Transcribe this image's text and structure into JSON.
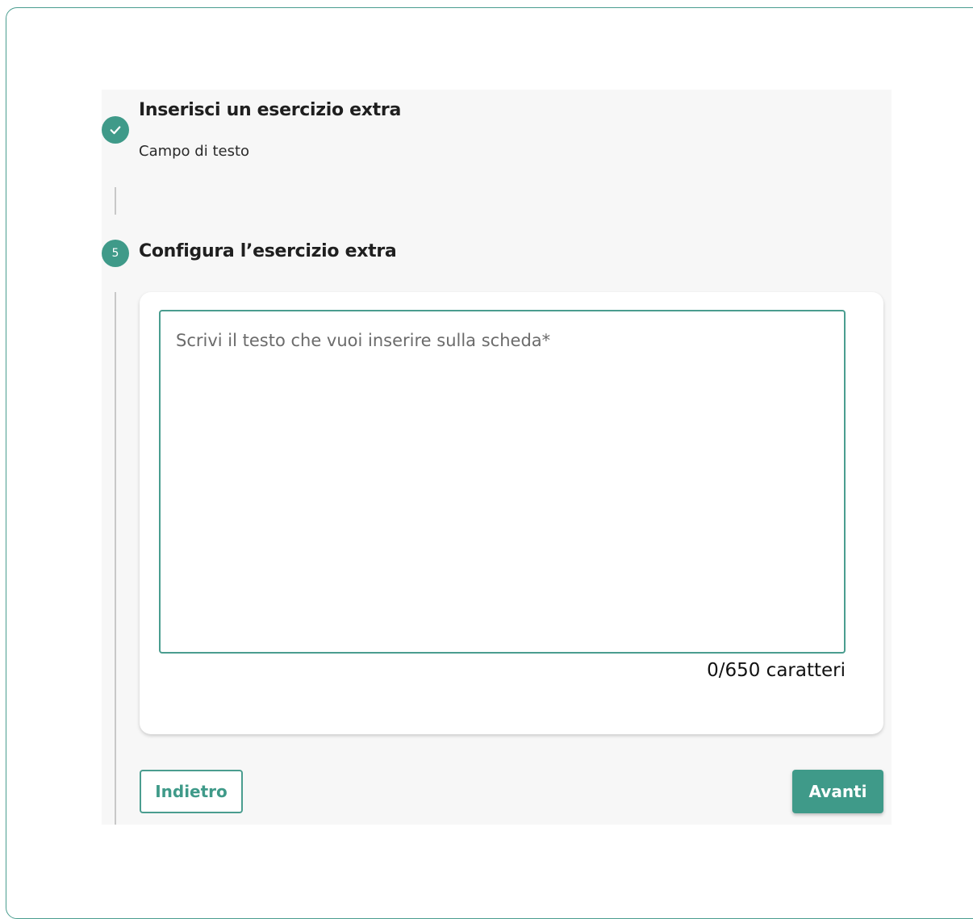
{
  "colors": {
    "accent": "#3f9a89",
    "border": "#4a9d8f",
    "panel_background": "#f7f7f7"
  },
  "steps": [
    {
      "status": "completed",
      "icon": "check-icon",
      "title": "Inserisci un esercizio extra",
      "subtitle": "Campo di testo"
    },
    {
      "status": "active",
      "number": "5",
      "title": "Configura l’esercizio extra"
    }
  ],
  "form": {
    "textarea_value": "",
    "textarea_placeholder": "Scrivi il testo che vuoi inserire sulla scheda*",
    "char_counter": "0/650 caratteri"
  },
  "actions": {
    "back_label": "Indietro",
    "next_label": "Avanti"
  }
}
